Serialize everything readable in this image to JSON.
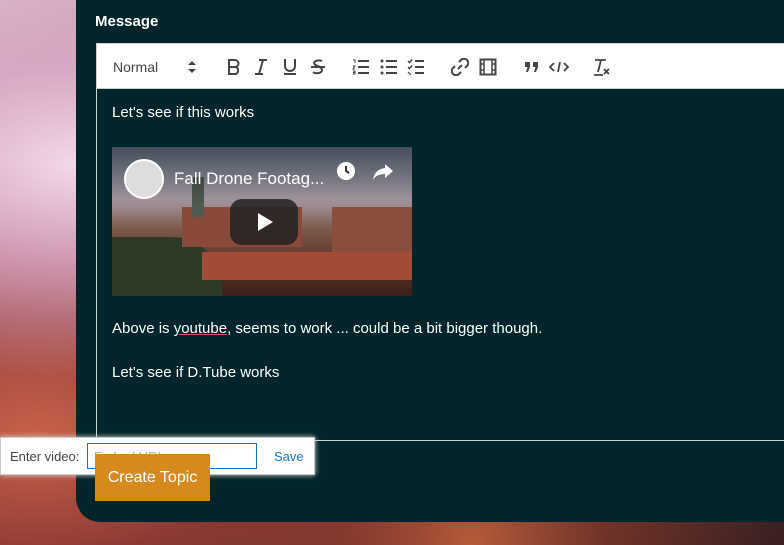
{
  "form": {
    "message_label": "Message",
    "submit_label": "Create Topic"
  },
  "toolbar": {
    "header_select_value": "Normal",
    "buttons": [
      "bold-icon",
      "italic-icon",
      "underline-icon",
      "strike-icon",
      "ordered-list-icon",
      "bullet-list-icon",
      "check-list-icon",
      "link-icon",
      "video-icon",
      "blockquote-icon",
      "code-block-icon",
      "clear-format-icon"
    ]
  },
  "editor": {
    "line1": "Let's see if this works",
    "video_title": "Fall Drone Footag...",
    "line2_pre": "Above is ",
    "line2_link": "youtube",
    "line2_post": ", seems to work ... could be a bit bigger though.",
    "line3": "Let's see if D.Tube works"
  },
  "video_tooltip": {
    "label": "Enter video:",
    "placeholder": "Embed URL",
    "save_label": "Save"
  },
  "colors": {
    "panel": "#00252a",
    "button": "#d68a1e",
    "link": "#1a73c9"
  }
}
